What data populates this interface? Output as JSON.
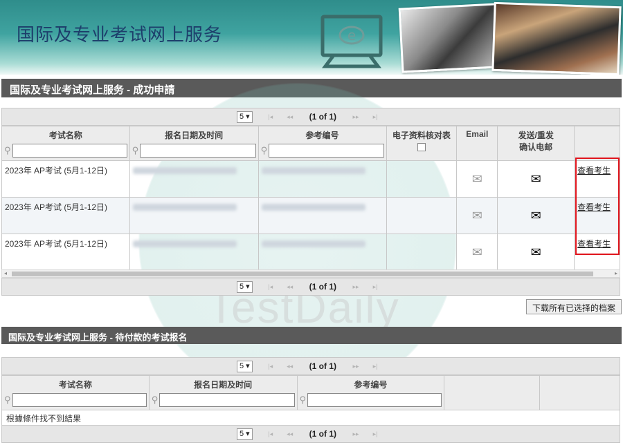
{
  "banner": {
    "title": "国际及专业考试网上服务",
    "monitor_glyph": "e"
  },
  "section1": {
    "title": "国际及专业考试网上服务 - 成功申請"
  },
  "paginator": {
    "rows": "5",
    "first": "|◂",
    "prev": "◂◂",
    "page": "(1 of 1)",
    "next": "▸▸",
    "last": "▸|"
  },
  "table1": {
    "headers": [
      "考试名称",
      "报名日期及时间",
      "参考编号",
      "电子资料核对表",
      "Email",
      "发送/重发",
      "确认电邮"
    ],
    "rows": [
      {
        "exam": "2023年 AP考试 (5月1-12日)",
        "link": "查看考生"
      },
      {
        "exam": "2023年 AP考试 (5月1-12日)",
        "link": "查看考生"
      },
      {
        "exam": "2023年 AP考试 (5月1-12日)",
        "link": "查看考生"
      }
    ]
  },
  "download_button": "下载所有已选择的档案",
  "section2": {
    "title": "国际及专业考试网上服务 - 待付款的考试报名"
  },
  "table2": {
    "headers": [
      "考试名称",
      "报名日期及时间",
      "参考编号"
    ],
    "empty": "根據條件找不到結果"
  },
  "watermark": "TestDaily",
  "colors": {
    "banner": "#3fa3a0",
    "section_bar": "#5a5a5a",
    "highlight": "#e0141c"
  }
}
